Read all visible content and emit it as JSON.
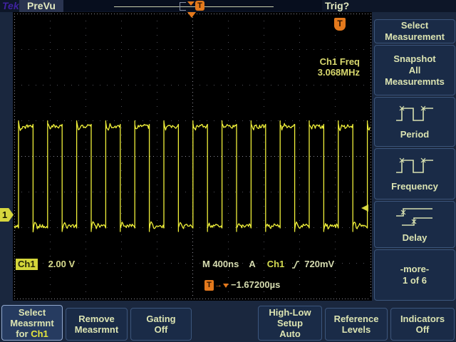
{
  "colors": {
    "page_bg": "#1a273e",
    "topbar_bg": "#0d1628",
    "screen_bg": "#000000",
    "box_bg": "#1a2b47",
    "box_border": "#3c567c",
    "text": "#dce4b2",
    "trace": "#f0f03a",
    "orange": "#e4791c",
    "tek_purple": "#3f22a0",
    "grid_dim": "#50505a",
    "grid_bright": "#8e8e98"
  },
  "topbar": {
    "logo": "Tek",
    "mode": "PreVu",
    "trig_status": "Trig?",
    "trigger_glyph": "T"
  },
  "screen": {
    "freq_label": "Ch1 Freq",
    "freq_value": "3.068MHz",
    "channel_marker": "1",
    "trigger_badge": "T",
    "ch_readout": {
      "badge": "Ch1",
      "scale": "2.00 V"
    },
    "horiz_readout": {
      "time": "M 400ns",
      "source_prefix": "A",
      "source": "Ch1",
      "level": "720mV"
    },
    "delay_readout": {
      "badge": "T",
      "value": "−1.67200µs"
    }
  },
  "side_menu": {
    "items": [
      {
        "lines": [
          "Select",
          "Measurement"
        ]
      },
      {
        "lines": [
          "Snapshot",
          "All",
          "Measuremnts"
        ]
      },
      {
        "icon": "period-waveform-icon",
        "label": "Period"
      },
      {
        "icon": "frequency-waveform-icon",
        "label": "Frequency"
      },
      {
        "icon": "delay-waveform-icon",
        "label": "Delay"
      },
      {
        "lines": [
          "-more-",
          "1 of 6"
        ]
      }
    ]
  },
  "bottom_menu": {
    "items": [
      {
        "lines": [
          "Select",
          "Measrmnt"
        ],
        "suffix_plain": "for ",
        "suffix_highlight": "Ch1",
        "active": true
      },
      {
        "lines": [
          "Remove",
          "Measrmnt"
        ]
      },
      {
        "lines": [
          "Gating",
          "Off"
        ]
      },
      {
        "lines": [
          "High-Low",
          "Setup",
          "Auto"
        ]
      },
      {
        "lines": [
          "Reference",
          "Levels"
        ]
      },
      {
        "lines": [
          "Indicators",
          "Off"
        ]
      }
    ]
  },
  "waveform": {
    "type": "square",
    "frequency_mhz": 3.068,
    "time_per_div_ns": 400,
    "volts_per_div": 2.0,
    "high_v": 4.9,
    "low_v": -0.68,
    "duty": 0.5
  }
}
